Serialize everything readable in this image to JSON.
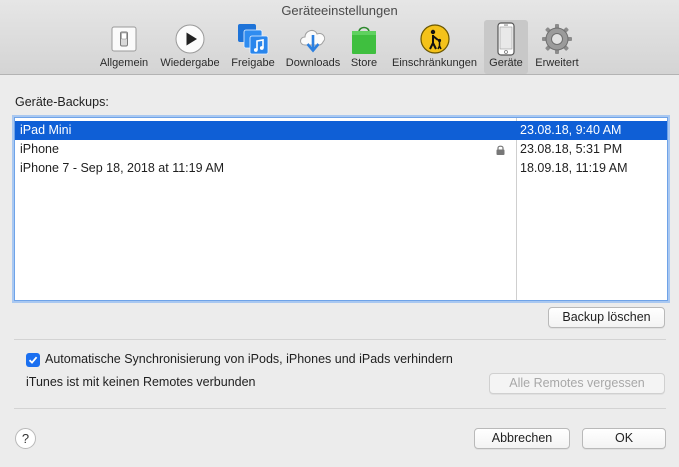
{
  "window": {
    "title": "Geräteeinstellungen"
  },
  "toolbar": {
    "items": [
      {
        "label": "Allgemein",
        "icon": "switch-icon"
      },
      {
        "label": "Wiedergabe",
        "icon": "play-icon"
      },
      {
        "label": "Freigabe",
        "icon": "sharing-icon"
      },
      {
        "label": "Downloads",
        "icon": "cloud-download-icon"
      },
      {
        "label": "Store",
        "icon": "store-bag-icon"
      },
      {
        "label": "Einschränkungen",
        "icon": "parental-icon"
      },
      {
        "label": "Geräte",
        "icon": "iphone-icon",
        "selected": true
      },
      {
        "label": "Erweitert",
        "icon": "gear-icon"
      }
    ]
  },
  "backups": {
    "label": "Geräte-Backups:",
    "rows": [
      {
        "name": "iPad Mini",
        "date": "23.08.18, 9:40 AM",
        "selected": true,
        "locked": false
      },
      {
        "name": "iPhone",
        "date": "23.08.18, 5:31 PM",
        "selected": false,
        "locked": true
      },
      {
        "name": "iPhone 7 - Sep 18, 2018 at 11:19 AM",
        "date": "18.09.18, 11:19 AM",
        "selected": false,
        "locked": false
      }
    ],
    "delete_button": "Backup löschen"
  },
  "sync": {
    "checkbox_label": "Automatische Synchronisierung von iPods, iPhones und iPads verhindern",
    "checked": true,
    "remotes_status": "iTunes ist mit keinen Remotes verbunden",
    "forget_remotes_button": "Alle Remotes vergessen"
  },
  "footer": {
    "help": "?",
    "cancel_button": "Abbrechen",
    "ok_button": "OK"
  },
  "colors": {
    "accent": "#0f5fd6",
    "window_bg": "#ececec"
  }
}
